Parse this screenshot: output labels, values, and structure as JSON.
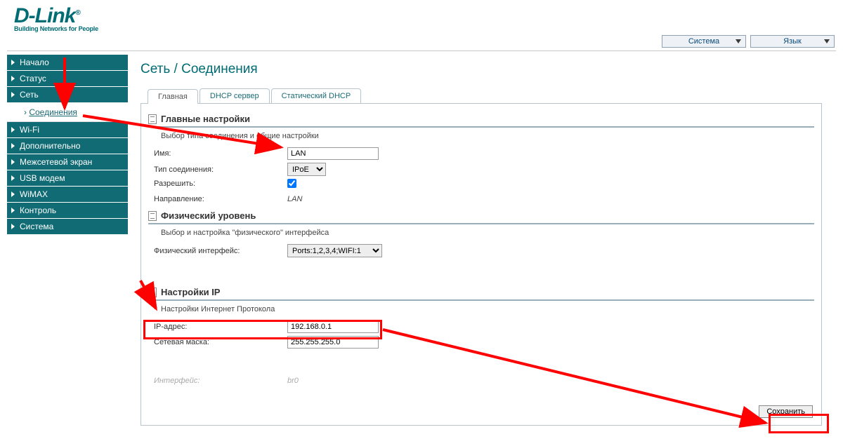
{
  "brand": {
    "name": "D-Link",
    "tagline": "Building Networks for People"
  },
  "topbar": {
    "system": "Система",
    "language": "Язык"
  },
  "sidebar": {
    "items": [
      {
        "label": "Начало"
      },
      {
        "label": "Статус"
      },
      {
        "label": "Сеть"
      },
      {
        "label": "Wi-Fi"
      },
      {
        "label": "Дополнительно"
      },
      {
        "label": "Межсетевой экран"
      },
      {
        "label": "USB модем"
      },
      {
        "label": "WiMAX"
      },
      {
        "label": "Контроль"
      },
      {
        "label": "Система"
      }
    ],
    "sub": {
      "label": "Соединения"
    }
  },
  "page": {
    "title": "Сеть  / Соединения"
  },
  "tabs": [
    {
      "label": "Главная"
    },
    {
      "label": "DHCP сервер"
    },
    {
      "label": "Статический DHCP"
    }
  ],
  "s1": {
    "title": "Главные настройки",
    "caption": "Выбор типа соединения и общие настройки",
    "name_label": "Имя:",
    "name_value": "LAN",
    "type_label": "Тип соединения:",
    "type_value": "IPoE",
    "allow_label": "Разрешить:",
    "dir_label": "Направление:",
    "dir_value": "LAN"
  },
  "s2": {
    "title": "Физический уровень",
    "caption": "Выбор и настройка \"физического\" интерфейса",
    "pif_label": "Физический интерфейс:",
    "pif_value": "Ports:1,2,3,4;WIFI:1"
  },
  "s3": {
    "title": "Настройки IP",
    "caption": "Настройки Интернет Протокола",
    "ip_label": "IP-адрес:",
    "ip_value": "192.168.0.1",
    "mask_label": "Сетевая маска:",
    "mask_value": "255.255.255.0",
    "iface_label": "Интерфейс:",
    "iface_value": "br0"
  },
  "buttons": {
    "save": "Сохранить"
  }
}
